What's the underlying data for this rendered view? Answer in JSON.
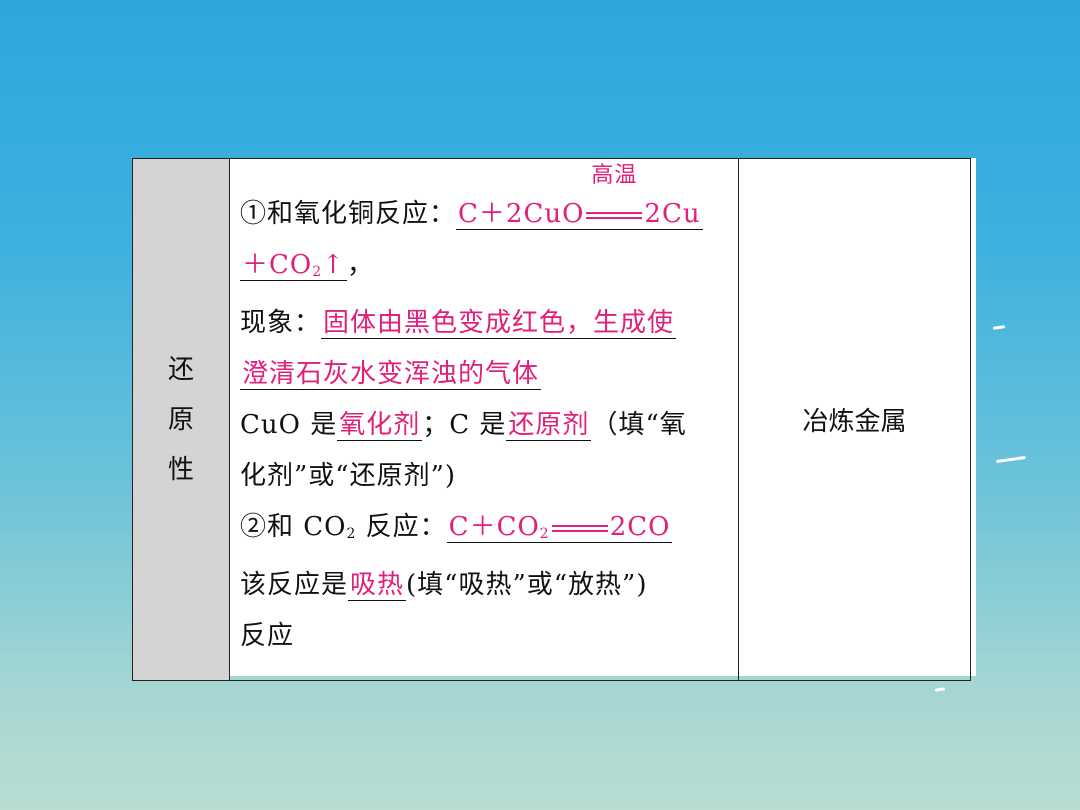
{
  "table": {
    "row_label": "还原性",
    "line1_prefix": "①和氧化铜反应：",
    "line1_eq_left": "C＋2CuO",
    "line1_eq_condition": "高温",
    "line1_eq_right": "2Cu",
    "line2_eq_tail": "＋CO",
    "line2_eq_tail_sub": "2",
    "line2_eq_arrow": "↑",
    "line2_after": "，",
    "line3_prefix": "现象：",
    "line3_answer": "固体由黑色变成红色，生成使",
    "line4_answer": "澄清石灰水变浑浊的气体",
    "line5_text1": "CuO 是",
    "line5_answer1": "氧化剂",
    "line5_text2": "；C 是",
    "line5_answer2": "还原剂",
    "line5_text3": "（填“氧",
    "line6_text": "化剂”或“还原剂”)",
    "line7_prefix": "②和 CO",
    "line7_prefix_sub": "2",
    "line7_prefix_after": " 反应：",
    "line7_eq_left": "C＋CO",
    "line7_eq_left_sub": "2",
    "line7_eq_right": "2CO",
    "line8_text1": "该反应是",
    "line8_answer": "吸热",
    "line8_text2": "(填“吸热”或“放热”)",
    "line9_text": "反应",
    "use": "冶炼金属"
  },
  "colors": {
    "answer": "#e0207a",
    "label_bg": "#d4d4d4"
  }
}
